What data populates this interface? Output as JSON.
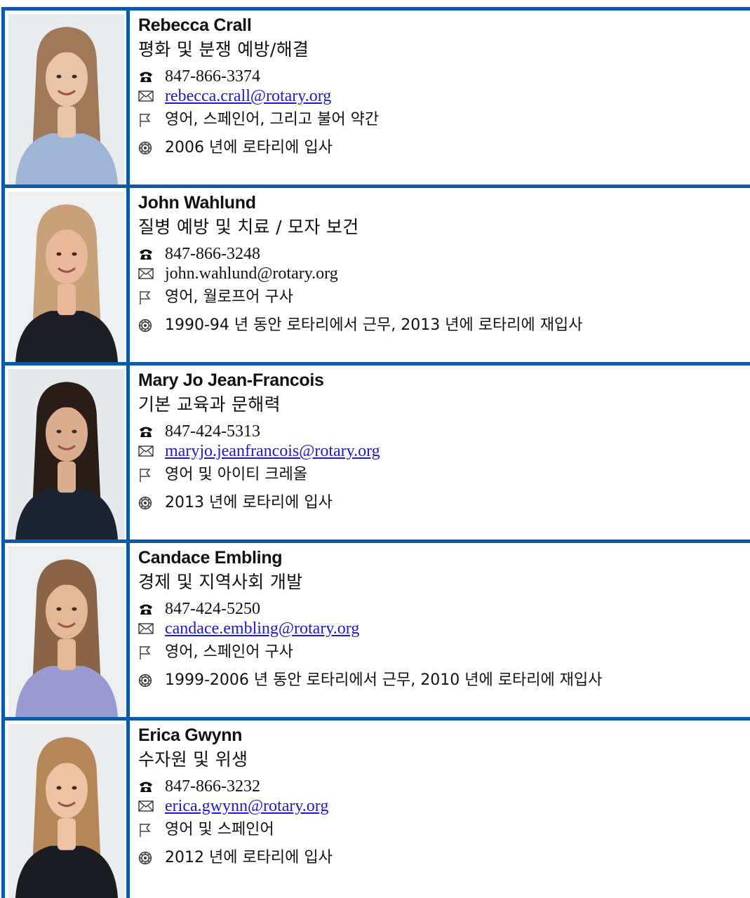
{
  "staff": [
    {
      "name": "Rebecca Crall",
      "focus": "평화 및 분쟁 예방/해결",
      "phone": "847-866-3374",
      "email": "rebecca.crall@rotary.org",
      "email_linked": true,
      "languages": "영어, 스페인어, 그리고 불어 약간",
      "joined": "2006 년에 로타리에 입사",
      "photo": {
        "bg": "#e9ecee",
        "hair": "#a07a58",
        "skin": "#e8c4a8",
        "top": "#9eb5d6"
      }
    },
    {
      "name": "John Wahlund",
      "focus": "질병 예방 및 치료 / 모자 보건",
      "phone": "847-866-3248",
      "email": "john.wahlund@rotary.org",
      "email_linked": false,
      "languages": "영어, 월로프어 구사",
      "joined": "1990-94 년 동안 로타리에서 근무, 2013 년에 로타리에 재입사",
      "photo": {
        "bg": "#eef0f1",
        "hair": "#c7a178",
        "skin": "#e9b89a",
        "top": "#1d1f24"
      }
    },
    {
      "name": "Mary Jo Jean-Francois",
      "focus": "기본 교육과 문해력",
      "phone": "847-424-5313",
      "email": "maryjo.jeanfrancois@rotary.org",
      "email_linked": true,
      "languages": "영어 및 아이티 크레올",
      "joined": "2013 년에 로타리에 입사",
      "photo": {
        "bg": "#e6e9ec",
        "hair": "#2a1d18",
        "skin": "#d9ad8e",
        "top": "#1c2433"
      }
    },
    {
      "name": "Candace Embling",
      "focus": "경제 및 지역사회 개발",
      "phone": "847-424-5250",
      "email": "candace.embling@rotary.org",
      "email_linked": true,
      "languages": "영어, 스페인어 구사",
      "joined": "1999-2006 년 동안 로타리에서 근무, 2010 년에 로타리에 재입사",
      "photo": {
        "bg": "#eceeef",
        "hair": "#8a6446",
        "skin": "#e3b896",
        "top": "#9a9ad0"
      }
    },
    {
      "name": "Erica Gwynn",
      "focus": "수자원 및 위생",
      "phone": "847-866-3232",
      "email": "erica.gwynn@rotary.org",
      "email_linked": true,
      "languages": "영어 및 스페인어",
      "joined": "2012 년에 로타리에 입사",
      "photo": {
        "bg": "#eaeced",
        "hair": "#b58658",
        "skin": "#ecc4a4",
        "top": "#1a1c22"
      }
    }
  ],
  "icons": {
    "phone": "phone-icon",
    "email": "envelope-icon",
    "language": "flag-icon",
    "joined": "rotary-wheel-icon"
  },
  "colors": {
    "border": "#0b5aa8",
    "link": "#1a1ad6"
  }
}
